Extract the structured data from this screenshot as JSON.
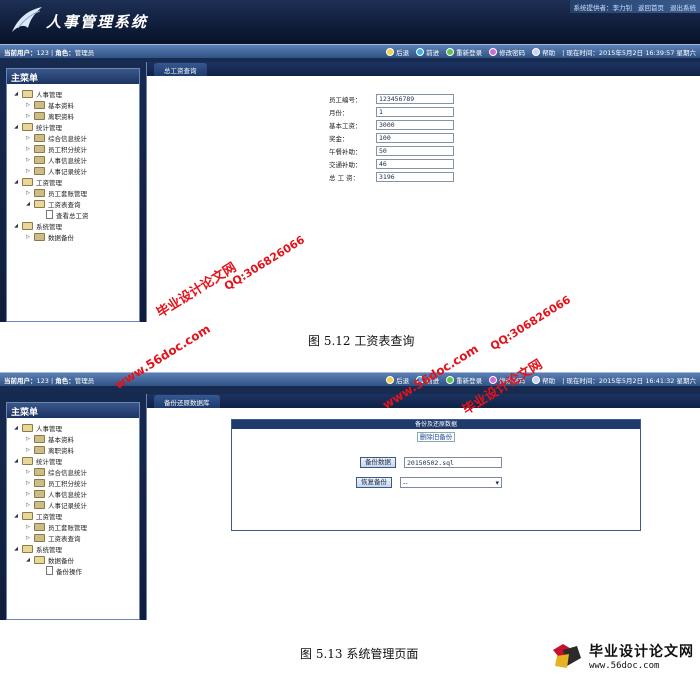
{
  "screen1": {
    "system_title": "人事管理系统",
    "top_links": [
      "系统提供者：李力钊",
      "返回首页",
      "退出系统"
    ],
    "user_label": "当前用户：",
    "user_value": "123",
    "role_label": "角色：",
    "role_value": "管理员",
    "toolbar": [
      "后退",
      "前进",
      "重新登录",
      "修改密码",
      "帮助"
    ],
    "time_label": "现在时间：",
    "time_value": "2015年5月2日 16:39:57 星期六",
    "sidebar_title": "主菜单",
    "tree": [
      {
        "label": "人事管理",
        "level": 1,
        "kind": "open"
      },
      {
        "label": "基本资料",
        "level": 2,
        "kind": "folder"
      },
      {
        "label": "离职资料",
        "level": 2,
        "kind": "folder"
      },
      {
        "label": "统计管理",
        "level": 1,
        "kind": "open"
      },
      {
        "label": "综合信息统计",
        "level": 2,
        "kind": "folder"
      },
      {
        "label": "员工积分统计",
        "level": 2,
        "kind": "folder"
      },
      {
        "label": "人事信息统计",
        "level": 2,
        "kind": "folder"
      },
      {
        "label": "人事记录统计",
        "level": 2,
        "kind": "folder"
      },
      {
        "label": "工资管理",
        "level": 1,
        "kind": "open"
      },
      {
        "label": "员工套账管理",
        "level": 2,
        "kind": "folder"
      },
      {
        "label": "工资表查询",
        "level": 2,
        "kind": "open"
      },
      {
        "label": "查看总工资",
        "level": 3,
        "kind": "doc"
      },
      {
        "label": "系统管理",
        "level": 1,
        "kind": "open"
      },
      {
        "label": "数据备份",
        "level": 2,
        "kind": "folder"
      }
    ],
    "tab": "总工资查询",
    "fields": [
      {
        "label": "员工编号：",
        "value": "123456789"
      },
      {
        "label": "月份：",
        "value": "1"
      },
      {
        "label": "基本工资：",
        "value": "3000"
      },
      {
        "label": "奖金：",
        "value": "100"
      },
      {
        "label": "午餐补助：",
        "value": "50"
      },
      {
        "label": "交通补助：",
        "value": "46"
      },
      {
        "label": "总 工 资：",
        "value": "3196"
      }
    ]
  },
  "caption1": "图 5.12  工资表查询",
  "screen2": {
    "user_label": "当前用户：",
    "user_value": "123",
    "role_label": "角色：",
    "role_value": "管理员",
    "toolbar": [
      "后退",
      "前进",
      "重新登录",
      "修改密码",
      "帮助"
    ],
    "time_label": "现在时间：",
    "time_value": "2015年5月2日 16:41:32 星期六",
    "sidebar_title": "主菜单",
    "tree": [
      {
        "label": "人事管理",
        "level": 1,
        "kind": "open"
      },
      {
        "label": "基本资料",
        "level": 2,
        "kind": "folder"
      },
      {
        "label": "离职资料",
        "level": 2,
        "kind": "folder"
      },
      {
        "label": "统计管理",
        "level": 1,
        "kind": "open"
      },
      {
        "label": "综合信息统计",
        "level": 2,
        "kind": "folder"
      },
      {
        "label": "员工积分统计",
        "level": 2,
        "kind": "folder"
      },
      {
        "label": "人事信息统计",
        "level": 2,
        "kind": "folder"
      },
      {
        "label": "人事记录统计",
        "level": 2,
        "kind": "folder"
      },
      {
        "label": "工资管理",
        "level": 1,
        "kind": "open"
      },
      {
        "label": "员工套账管理",
        "level": 2,
        "kind": "folder"
      },
      {
        "label": "工资表查询",
        "level": 2,
        "kind": "folder"
      },
      {
        "label": "系统管理",
        "level": 1,
        "kind": "open"
      },
      {
        "label": "数据备份",
        "level": 2,
        "kind": "open"
      },
      {
        "label": "备份操作",
        "level": 3,
        "kind": "doc"
      }
    ],
    "tab": "备份还原数据库",
    "panel_title": "备份及还原数据",
    "delete_link": "删除旧备份",
    "backup_button": "备份数据",
    "backup_value": "20150502.sql",
    "restore_button": "恢复备份",
    "restore_value": "--"
  },
  "caption2": "图 5.13  系统管理页面",
  "watermarks": {
    "site": "www.56doc.com",
    "qq": "QQ:306826066",
    "name": "毕业设计论文网"
  },
  "footer": {
    "title": "毕业设计论文网",
    "url": "www.56doc.com"
  }
}
